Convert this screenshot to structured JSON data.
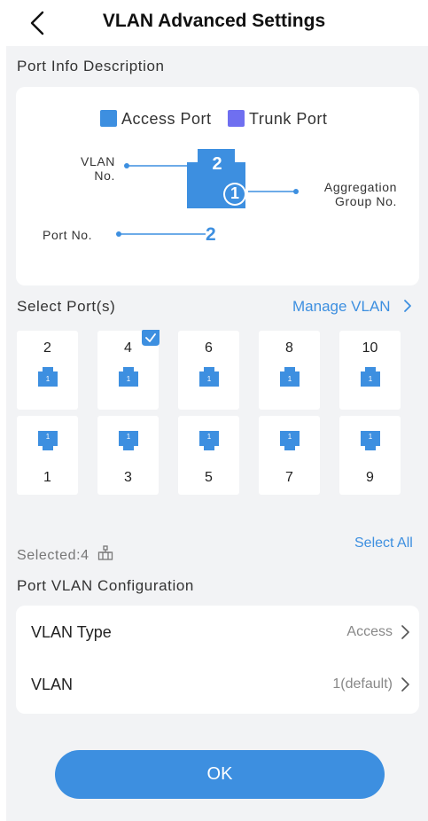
{
  "header": {
    "title": "VLAN Advanced Settings",
    "back_icon": "chevron-left-icon"
  },
  "port_info": {
    "section_title": "Port Info Description",
    "legend": [
      {
        "label": "Access Port",
        "color": "#3d8fe0"
      },
      {
        "label": "Trunk Port",
        "color": "#6f6ff0"
      }
    ],
    "diagram": {
      "vlan_label_line1": "VLAN",
      "vlan_label_line2": "No.",
      "vlan_value": "2",
      "aggregation_label_line1": "Aggregation",
      "aggregation_label_line2": "Group No.",
      "aggregation_value": "1",
      "port_label": "Port No.",
      "port_value": "2"
    }
  },
  "select_ports": {
    "section_title": "Select Port(s)",
    "manage_vlan": "Manage VLAN",
    "top_row": [
      {
        "number": "2",
        "vlan": "1",
        "selected": false
      },
      {
        "number": "4",
        "vlan": "1",
        "selected": true
      },
      {
        "number": "6",
        "vlan": "1",
        "selected": false
      },
      {
        "number": "8",
        "vlan": "1",
        "selected": false
      },
      {
        "number": "10",
        "vlan": "1",
        "selected": false
      }
    ],
    "bottom_row": [
      {
        "number": "1",
        "vlan": "1"
      },
      {
        "number": "3",
        "vlan": "1"
      },
      {
        "number": "5",
        "vlan": "1"
      },
      {
        "number": "7",
        "vlan": "1"
      },
      {
        "number": "9",
        "vlan": "1"
      }
    ],
    "selected_text": "Selected:4",
    "select_all": "Select All"
  },
  "vlan_config": {
    "section_title": "Port VLAN Configuration",
    "rows": [
      {
        "label": "VLAN Type",
        "value": "Access"
      },
      {
        "label": "VLAN",
        "value": "1(default)"
      }
    ]
  },
  "ok_label": "OK",
  "colors": {
    "accent": "#3d8fe0",
    "trunk": "#6f6ff0",
    "background": "#f2f3f5"
  }
}
